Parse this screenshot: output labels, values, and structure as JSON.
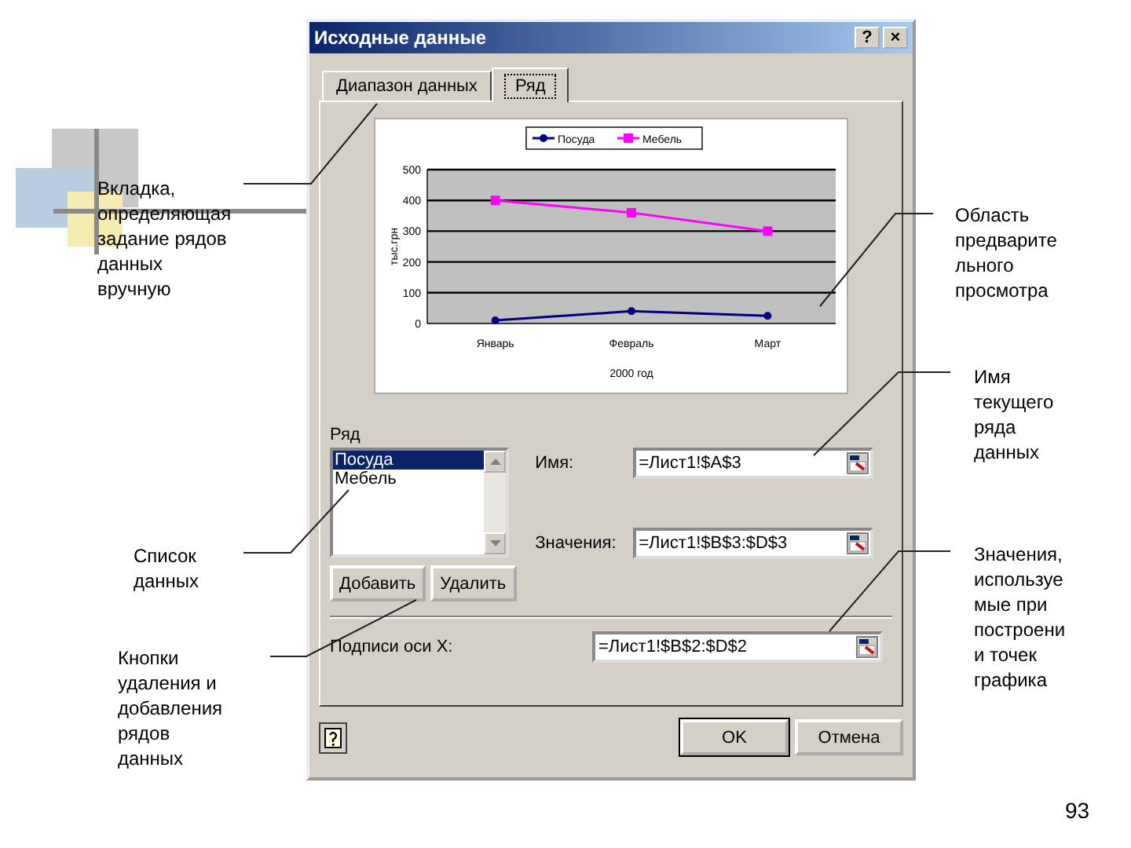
{
  "dialog": {
    "title": "Исходные данные",
    "title_buttons": [
      "?",
      "×"
    ],
    "tabs": [
      {
        "label": "Диапазон данных",
        "selected": false
      },
      {
        "label": "Ряд",
        "selected": true
      }
    ],
    "chart_data": {
      "type": "line",
      "grid": true,
      "legend": true,
      "xlabel": "2000 год",
      "ylabel": "тыс.грн",
      "categories": [
        "Январь",
        "Февраль",
        "Март"
      ],
      "ylim": [
        0,
        500
      ],
      "yticks": [
        0,
        100,
        200,
        300,
        400,
        500
      ],
      "series": [
        {
          "name": "Посуда",
          "color": "#000080",
          "marker": "circle",
          "values": [
            10,
            40,
            25
          ]
        },
        {
          "name": "Мебель",
          "color": "#ff00ff",
          "marker": "square",
          "values": [
            400,
            360,
            300
          ]
        }
      ]
    },
    "series_group": {
      "label": "Ряд",
      "items": [
        {
          "label": "Посуда",
          "selected": true
        },
        {
          "label": "Мебель",
          "selected": false
        }
      ]
    },
    "fields": [
      {
        "label": "Имя:",
        "value": "=Лист1!$A$3"
      },
      {
        "label": "Значения:",
        "value": "=Лист1!$B$3:$D$3"
      }
    ],
    "list_buttons": [
      "Добавить",
      "Удалить"
    ],
    "axis_field": {
      "label": "Подписи оси X:",
      "value": "=Лист1!$B$2:$D$2"
    },
    "footer_buttons": [
      "OK",
      "Отмена"
    ]
  },
  "annotations": [
    {
      "text": "Вкладка,\nопределяющая\nзадание рядов\nданных\nвручную"
    },
    {
      "text": "Область\nпредварите\nльного\nпросмотра"
    },
    {
      "text": "Имя\nтекущего\nряда\nданных"
    },
    {
      "text": "Список\nданных"
    },
    {
      "text": "Значения,\nиспользуе\nмые при\nпостроени\nи точек\nграфика"
    },
    {
      "text": "Кнопки\nудаления и\nдобавления\nрядов\nданных"
    }
  ],
  "page_number": "93"
}
